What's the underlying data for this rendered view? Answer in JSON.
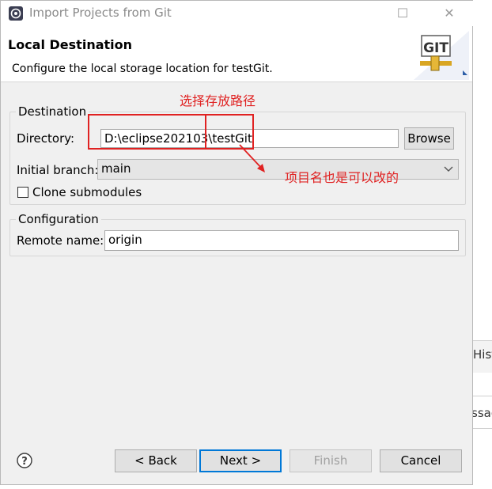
{
  "window": {
    "title": "Import Projects from Git",
    "minimize": "☐",
    "close": "✕"
  },
  "header": {
    "title": "Local Destination",
    "description": "Configure the local storage location for testGit.",
    "logo_text": "GIT"
  },
  "destination": {
    "legend": "Destination",
    "directory_label": "Directory:",
    "directory_value": "D:\\eclipse202103\\testGit",
    "browse_label": "Browse",
    "branch_label": "Initial branch:",
    "branch_value": "main",
    "clone_submodules_label": "Clone submodules",
    "clone_submodules_checked": false
  },
  "configuration": {
    "legend": "Configuration",
    "remote_label": "Remote name:",
    "remote_value": "origin"
  },
  "annotations": {
    "path_note": "选择存放路径",
    "name_note": "项目名也是可以改的",
    "color": "#e02222"
  },
  "footer": {
    "back_label": "< Back",
    "next_label": "Next >",
    "finish_label": "Finish",
    "cancel_label": "Cancel"
  },
  "background": {
    "frag1": "Hist",
    "frag2": "ssag"
  }
}
